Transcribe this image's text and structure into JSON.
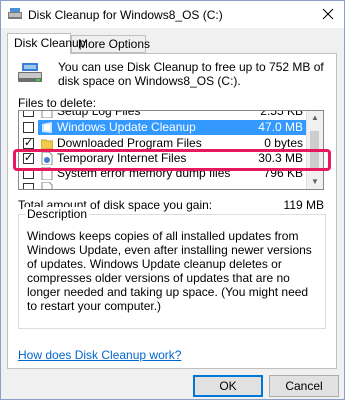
{
  "window": {
    "title": "Disk Cleanup for Windows8_OS (C:)",
    "close_symbol": "✕"
  },
  "tabs": [
    {
      "label": "Disk Cleanup",
      "active": true
    },
    {
      "label": "More Options",
      "active": false
    }
  ],
  "intro_text": "You can use Disk Cleanup to free up to 752 MB of disk space on Windows8_OS (C:).",
  "files_label": "Files to delete:",
  "files": [
    {
      "name": "Setup Log Files",
      "size": "2.55 KB",
      "checked": false,
      "icon": "document-icon"
    },
    {
      "name": "Windows Update Cleanup",
      "size": "47.0 MB",
      "checked": false,
      "icon": "windows-update-icon",
      "selected": true
    },
    {
      "name": "Downloaded Program Files",
      "size": "0 bytes",
      "checked": true,
      "icon": "folder-icon"
    },
    {
      "name": "Temporary Internet Files",
      "size": "30.3 MB",
      "checked": true,
      "icon": "internet-files-icon"
    },
    {
      "name": "System error memory dump files",
      "size": "796 KB",
      "checked": false,
      "icon": "document-icon"
    },
    {
      "name": "",
      "size": "",
      "checked": false,
      "icon": "document-icon"
    }
  ],
  "total": {
    "label": "Total amount of disk space you gain:",
    "value": "119 MB"
  },
  "description": {
    "legend": "Description",
    "text": "Windows keeps copies of all installed updates from Windows Update, even after installing newer versions of updates. Windows Update cleanup deletes or compresses older versions of updates that are no longer needed and taking up space. (You might need to restart your computer.)"
  },
  "help_link": "How does Disk Cleanup work?",
  "buttons": {
    "ok": "OK",
    "cancel": "Cancel"
  },
  "colors": {
    "selection": "#3399ff",
    "highlight_border": "#e8195a",
    "link": "#0066cc",
    "default_button_border": "#0078d7"
  }
}
